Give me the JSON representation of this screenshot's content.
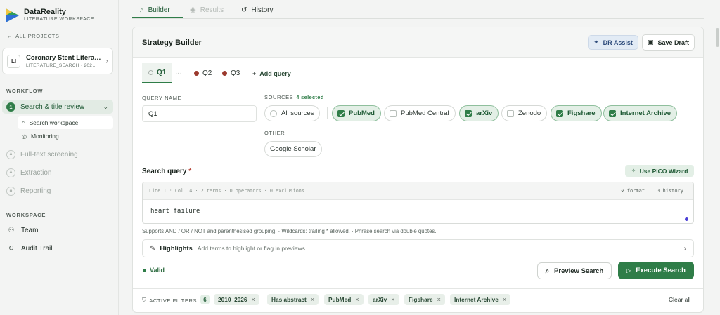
{
  "brand": {
    "name": "DataReality",
    "subtitle": "LITERATURE WORKSPACE"
  },
  "nav": {
    "all_projects": "ALL PROJECTS"
  },
  "project": {
    "initials": "LI",
    "name": "Coronary Stent Litera…",
    "meta": "LITERATURE_SEARCH · 202…"
  },
  "workflow": {
    "label": "WORKFLOW",
    "items": [
      {
        "num": "1",
        "label": "Search & title review",
        "state": "active"
      },
      {
        "label": "Full-text screening",
        "state": "locked"
      },
      {
        "label": "Extraction",
        "state": "locked"
      },
      {
        "label": "Reporting",
        "state": "locked"
      }
    ],
    "subitems": [
      {
        "label": "Search workspace",
        "icon": "search-icon"
      },
      {
        "label": "Monitoring",
        "icon": "monitor-icon"
      }
    ]
  },
  "workspace": {
    "label": "WORKSPACE",
    "items": [
      {
        "label": "Team",
        "icon": "team-icon"
      },
      {
        "label": "Audit Trail",
        "icon": "audit-icon"
      }
    ]
  },
  "top_tabs": [
    {
      "label": "Builder",
      "state": "active"
    },
    {
      "label": "Results",
      "state": "disabled"
    },
    {
      "label": "History",
      "state": "normal"
    }
  ],
  "builder": {
    "title": "Strategy Builder",
    "assist_label": "DR Assist",
    "save_label": "Save Draft",
    "query_tabs": [
      {
        "label": "Q1"
      },
      {
        "label": "Q2"
      },
      {
        "label": "Q3"
      }
    ],
    "ellipsis": "···",
    "add_query": "Add query",
    "query_name_label": "QUERY NAME",
    "query_name_value": "Q1",
    "sources_label": "SOURCES",
    "sources_count": "4 selected",
    "all_sources": "All sources",
    "sources": [
      {
        "label": "PubMed",
        "selected": true
      },
      {
        "label": "PubMed Central",
        "selected": false
      },
      {
        "label": "arXiv",
        "selected": true
      },
      {
        "label": "Zenodo",
        "selected": false
      },
      {
        "label": "Figshare",
        "selected": true
      },
      {
        "label": "Internet Archive",
        "selected": true
      }
    ],
    "other_label": "OTHER",
    "other_source": "Google Scholar",
    "search_query_label": "Search query",
    "required_mark": "*",
    "pico_label": "Use PICO Wizard",
    "editor_status": "Line 1 : Col 14  ·  2 terms  ·  0 operators  ·  0 exclusions",
    "editor_format": "format",
    "editor_history": "history",
    "editor_value": "heart failure",
    "help_text": "Supports AND / OR / NOT and parenthesised grouping. · Wildcards: trailing * allowed. · Phrase search via double quotes.",
    "highlights_title": "Highlights",
    "highlights_desc": "Add terms to highlight or flag in previews",
    "valid_label": "Valid",
    "preview_label": "Preview Search",
    "execute_label": "Execute Search",
    "active_filters_label": "ACTIVE FILTERS",
    "active_filters_count": "6",
    "filters": [
      "2010–2026",
      "Has abstract",
      "PubMed",
      "arXiv",
      "Figshare",
      "Internet Archive"
    ],
    "clear_all": "Clear all"
  },
  "colors": {
    "accent": "#2f7d48",
    "accent_soft": "#e3efe6",
    "query_dot": "#9b3a2e"
  }
}
